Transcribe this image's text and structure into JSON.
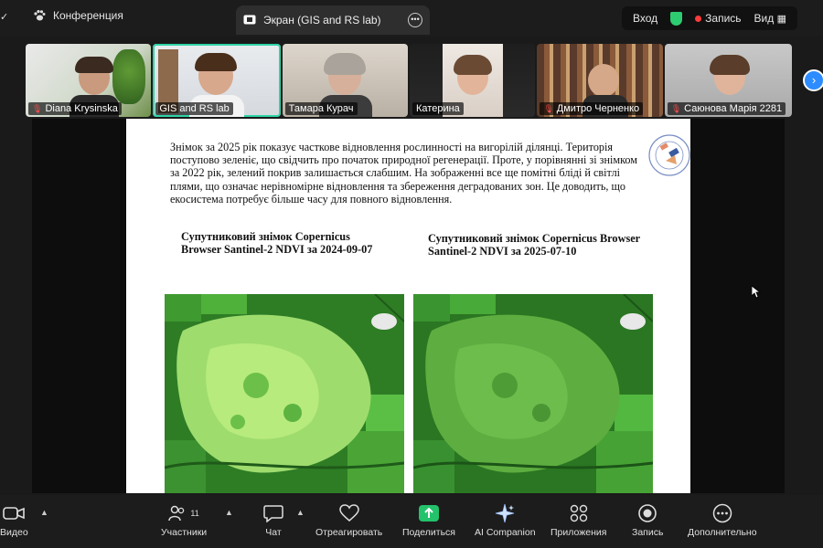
{
  "topbar": {
    "meeting_tab": "Конференция",
    "screen_tab": "Экран (GIS and RS lab)",
    "login": "Вход",
    "record": "Запись",
    "view": "Вид"
  },
  "participants": [
    {
      "name": "Diana Krysinska",
      "muted": true
    },
    {
      "name": "GIS and RS lab",
      "muted": false
    },
    {
      "name": "Тамара Курач",
      "muted": false
    },
    {
      "name": "Катерина",
      "muted": false
    },
    {
      "name": "Дмитро Черненко",
      "muted": true
    },
    {
      "name": "Саюнова Марія 2281",
      "muted": true
    }
  ],
  "doc": {
    "paragraph": "Знімок за 2025 рік показує часткове відновлення рослинності на вигорілій ділянці. Територія поступово зеленіє, що свідчить про початок природної регенерації. Проте, у порівнянні зі знімком за 2022 рік, зелений покрив залишається слабшим. На зображенні все ще помітні бліді й світлі плями, що означає нерівномірне відновлення та збереження деградованих зон. Це доводить, що екосистема потребує більше часу для повного відновлення.",
    "caption_left": "Супутниковий знімок Copernicus Browser Santinel-2 NDVI за 2024-09-07",
    "caption_right": "Супутниковий знімок Copernicus Browser Santinel-2 NDVI за 2025-07-10"
  },
  "toolbar": {
    "video": "Видео",
    "participants": "Участники",
    "participants_count": "11",
    "chat": "Чат",
    "react": "Отреагировать",
    "share": "Поделиться",
    "companion": "AI Companion",
    "apps": "Приложения",
    "record": "Запись",
    "more": "Дополнительно"
  },
  "colors": {
    "accent_green": "#2ed3a6",
    "share_green": "#23c26b",
    "record_red": "#ff3b3b",
    "link_blue": "#2d8cff",
    "ndvi_green": "#3a8a2c"
  }
}
